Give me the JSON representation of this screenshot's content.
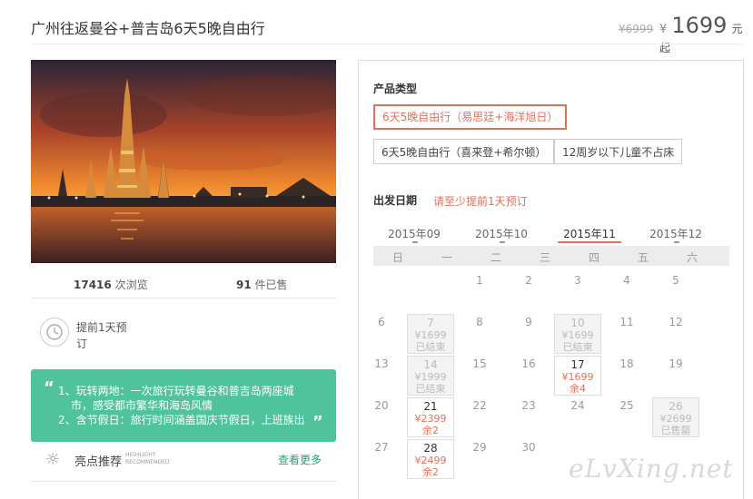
{
  "product": {
    "title": "广州往返曼谷+普吉岛6天5晚自由行",
    "price_old": "¥6999",
    "price_symbol": "¥",
    "price_value": "1699",
    "price_unit": "元起"
  },
  "stats": {
    "views_count": "17416",
    "views_label": "次浏览",
    "sold_count": "91",
    "sold_label": "件已售"
  },
  "advance": {
    "text": "提前1天预订"
  },
  "highlight": {
    "line1": "1、玩转两地：一次旅行玩转曼谷和普吉岛两座城",
    "line2": "市，感受都市繁华和海岛风情",
    "line3": "2、含节假日：旅行时间涵盖国庆节假日，上班族出",
    "open_quote": "“",
    "close_quote": "”"
  },
  "recommend": {
    "label": "亮点推荐",
    "en_line1": "HIGHLIGHT",
    "en_line2": "RECOMMENDED",
    "more": "查看更多"
  },
  "panel": {
    "type_title": "产品类型",
    "options": [
      "6天5晚自由行（易思廷+海洋旭日）",
      "6天5晚自由行（喜来登+希尔顿）",
      "12周岁以下儿童不占床"
    ],
    "date_title": "出发日期",
    "date_hint": "请至少提前1天预订",
    "months": [
      "2015年09",
      "2015年10",
      "2015年11",
      "2015年12"
    ],
    "active_month_index": 2,
    "weekdays": [
      "日",
      "一",
      "二",
      "三",
      "四",
      "五",
      "六"
    ]
  },
  "calendar": {
    "cells": [
      {
        "day": "1",
        "price": "",
        "status": "",
        "state": "plain"
      },
      {
        "day": "2",
        "price": "",
        "status": "",
        "state": "plain"
      },
      {
        "day": "3",
        "price": "",
        "status": "",
        "state": "plain"
      },
      {
        "day": "4",
        "price": "",
        "status": "",
        "state": "plain"
      },
      {
        "day": "5",
        "price": "",
        "status": "",
        "state": "plain"
      },
      {
        "day": "6",
        "price": "",
        "status": "",
        "state": "plain"
      },
      {
        "day": "7",
        "price": "¥1699",
        "status": "已结束",
        "state": "ended"
      },
      {
        "day": "8",
        "price": "",
        "status": "",
        "state": "plain"
      },
      {
        "day": "9",
        "price": "",
        "status": "",
        "state": "plain"
      },
      {
        "day": "10",
        "price": "¥1699",
        "status": "已结束",
        "state": "ended"
      },
      {
        "day": "11",
        "price": "",
        "status": "",
        "state": "plain"
      },
      {
        "day": "12",
        "price": "",
        "status": "",
        "state": "plain"
      },
      {
        "day": "13",
        "price": "",
        "status": "",
        "state": "plain"
      },
      {
        "day": "14",
        "price": "¥1999",
        "status": "已结束",
        "state": "ended"
      },
      {
        "day": "15",
        "price": "",
        "status": "",
        "state": "plain"
      },
      {
        "day": "16",
        "price": "",
        "status": "",
        "state": "plain"
      },
      {
        "day": "17",
        "price": "¥1699",
        "status": "余4",
        "state": "avail"
      },
      {
        "day": "18",
        "price": "",
        "status": "",
        "state": "plain"
      },
      {
        "day": "19",
        "price": "",
        "status": "",
        "state": "plain"
      },
      {
        "day": "20",
        "price": "",
        "status": "",
        "state": "plain"
      },
      {
        "day": "21",
        "price": "¥2399",
        "status": "余2",
        "state": "avail"
      },
      {
        "day": "22",
        "price": "",
        "status": "",
        "state": "plain"
      },
      {
        "day": "23",
        "price": "",
        "status": "",
        "state": "plain"
      },
      {
        "day": "24",
        "price": "",
        "status": "",
        "state": "plain"
      },
      {
        "day": "25",
        "price": "",
        "status": "",
        "state": "plain"
      },
      {
        "day": "26",
        "price": "¥2699",
        "status": "已售罄",
        "state": "ended"
      },
      {
        "day": "27",
        "price": "",
        "status": "",
        "state": "plain"
      },
      {
        "day": "28",
        "price": "¥2499",
        "status": "余2",
        "state": "avail"
      },
      {
        "day": "29",
        "price": "",
        "status": "",
        "state": "plain"
      },
      {
        "day": "30",
        "price": "",
        "status": "",
        "state": "plain"
      }
    ],
    "first_weekday": 2
  },
  "watermark": "eLvXing.net",
  "colors": {
    "accent": "#e0705a",
    "highlight_bg": "#4fc39c",
    "link_green": "#2a9d78"
  }
}
